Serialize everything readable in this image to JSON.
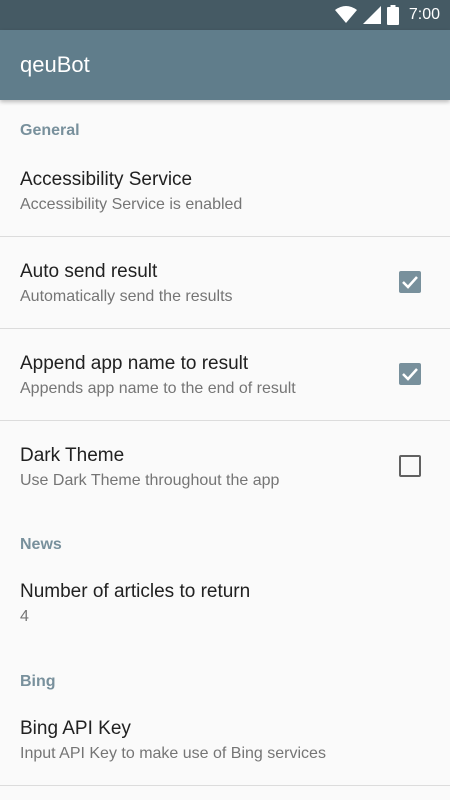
{
  "status_bar": {
    "time": "7:00"
  },
  "app_bar": {
    "title": "qeuBot"
  },
  "sections": {
    "general": "General",
    "news": "News",
    "bing": "Bing"
  },
  "prefs": {
    "accessibility": {
      "title": "Accessibility Service",
      "summary": "Accessibility Service is enabled"
    },
    "auto_send": {
      "title": "Auto send result",
      "summary": "Automatically send the results",
      "checked": true
    },
    "append_name": {
      "title": "Append app name to result",
      "summary": "Appends app name to the end of result",
      "checked": true
    },
    "dark_theme": {
      "title": "Dark Theme",
      "summary": "Use Dark Theme throughout the app",
      "checked": false
    },
    "articles": {
      "title": "Number of articles to return",
      "summary": "4"
    },
    "bing_key": {
      "title": "Bing API Key",
      "summary": "Input API Key to make use of Bing services"
    }
  },
  "colors": {
    "status_bar": "#455a64",
    "app_bar": "#607d8b",
    "accent": "#78909c"
  },
  "icons": [
    "wifi-icon",
    "cell-signal-icon",
    "battery-icon",
    "check-icon"
  ]
}
